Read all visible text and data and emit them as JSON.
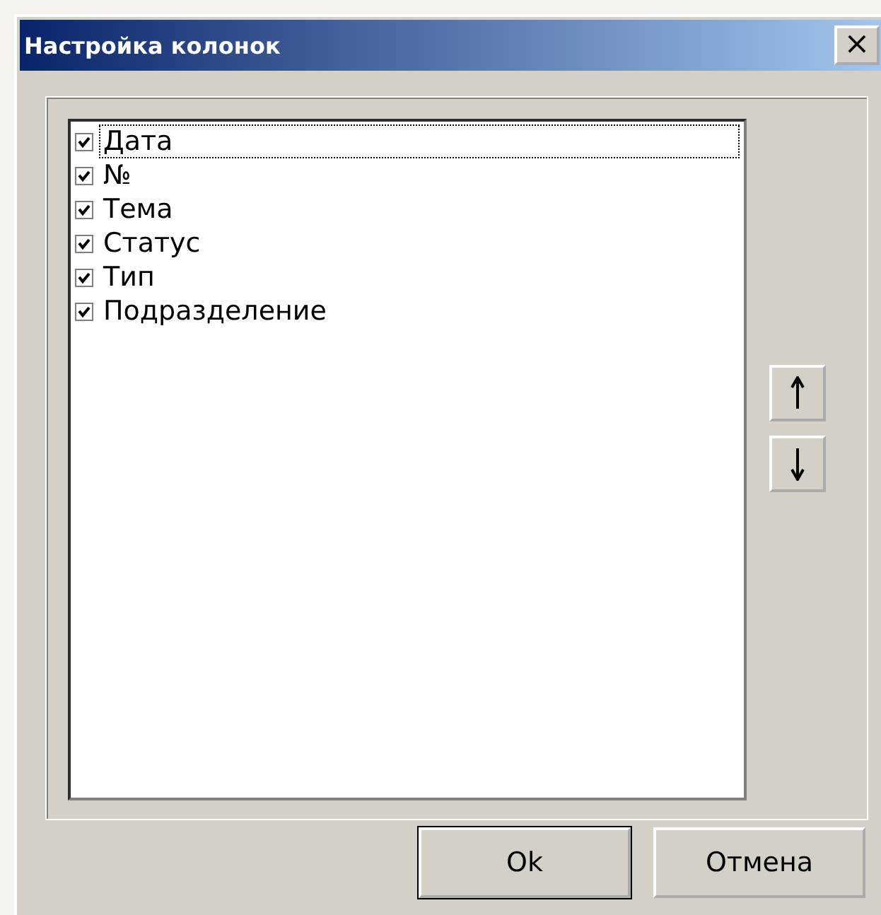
{
  "window": {
    "title": "Настройка колонок",
    "close": "×"
  },
  "columns": [
    {
      "label": "Дата",
      "checked": true,
      "selected": true
    },
    {
      "label": "№",
      "checked": true,
      "selected": false
    },
    {
      "label": "Тема",
      "checked": true,
      "selected": false
    },
    {
      "label": "Статус",
      "checked": true,
      "selected": false
    },
    {
      "label": "Тип",
      "checked": true,
      "selected": false
    },
    {
      "label": "Подразделение",
      "checked": true,
      "selected": false
    }
  ],
  "buttons": [
    {
      "label": "Ok",
      "default": true
    },
    {
      "label": "Отмена",
      "default": false
    }
  ]
}
